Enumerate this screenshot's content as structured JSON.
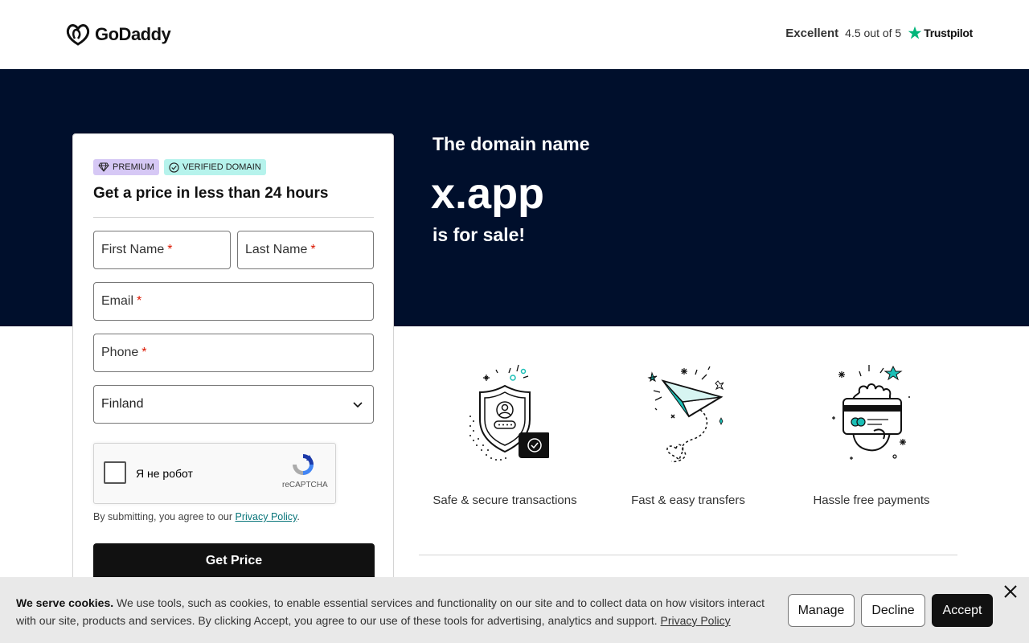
{
  "header": {
    "logo_text": "GoDaddy",
    "trustpilot": {
      "rating_word": "Excellent",
      "score_text": "4.5 out of 5",
      "brand": "Trustpilot"
    }
  },
  "hero": {
    "line1": "The domain name",
    "domain": "x.app",
    "line2": "is for sale!"
  },
  "form": {
    "badge_premium": "PREMIUM",
    "badge_verified": "VERIFIED DOMAIN",
    "title": "Get a price in less than 24 hours",
    "first_name_label": "First Name",
    "last_name_label": "Last Name",
    "email_label": "Email",
    "phone_label": "Phone",
    "required_mark": "*",
    "country_value": "Finland",
    "captcha_label": "Я не робот",
    "captcha_brand": "reCAPTCHA",
    "consent_prefix": "By submitting, you agree to our",
    "consent_link": "Privacy Policy",
    "consent_suffix": ".",
    "submit_label": "Get Price"
  },
  "features": [
    {
      "caption": "Safe & secure transactions",
      "icon": "shield-icon"
    },
    {
      "caption": "Fast & easy transfers",
      "icon": "paper-plane-icon"
    },
    {
      "caption": "Hassle free payments",
      "icon": "credit-card-hand-icon"
    }
  ],
  "cookie_banner": {
    "heading": "We serve cookies.",
    "body": "We use tools, such as cookies, to enable essential services and functionality on our site and to collect data on how visitors interact with our site, products and services. By clicking Accept, you agree to our use of these tools for advertising, analytics and support.",
    "link": "Privacy Policy",
    "manage_label": "Manage",
    "decline_label": "Decline",
    "accept_label": "Accept"
  },
  "colors": {
    "hero_bg": "#000f2c",
    "trustpilot_green": "#00b67a",
    "accent_teal": "#1bbfb6",
    "required_red": "#db1802",
    "link_teal": "#09757a",
    "premium_badge": "#d6c8f5",
    "verified_badge": "#b6f3ec"
  }
}
